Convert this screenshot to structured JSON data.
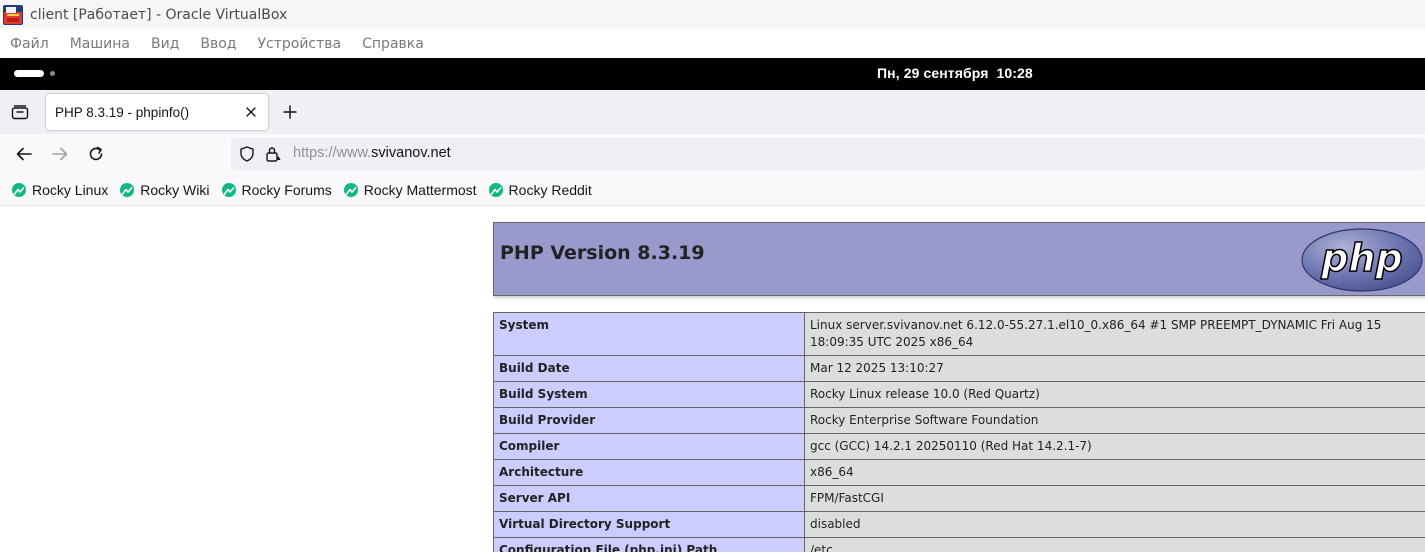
{
  "window": {
    "title": "client [Работает] - Oracle VirtualBox"
  },
  "vbox_menu": [
    "Файл",
    "Машина",
    "Вид",
    "Ввод",
    "Устройства",
    "Справка"
  ],
  "topbar": {
    "clock": "Пн, 29 сентября  10:28"
  },
  "browser": {
    "tab": {
      "title": "PHP 8.3.19 - phpinfo()"
    },
    "url": {
      "scheme": "https://www.",
      "host": "svivanov.net"
    },
    "bookmarks": [
      "Rocky Linux",
      "Rocky Wiki",
      "Rocky Forums",
      "Rocky Mattermost",
      "Rocky Reddit"
    ]
  },
  "phpinfo": {
    "heading": "PHP Version 8.3.19",
    "logo_text": "php",
    "rows": [
      {
        "key": "System",
        "value": "Linux server.svivanov.net 6.12.0-55.27.1.el10_0.x86_64 #1 SMP PREEMPT_DYNAMIC Fri Aug 15 18:09:35 UTC 2025 x86_64"
      },
      {
        "key": "Build Date",
        "value": "Mar 12 2025 13:10:27"
      },
      {
        "key": "Build System",
        "value": "Rocky Linux release 10.0 (Red Quartz)"
      },
      {
        "key": "Build Provider",
        "value": "Rocky Enterprise Software Foundation"
      },
      {
        "key": "Compiler",
        "value": "gcc (GCC) 14.2.1 20250110 (Red Hat 14.2.1-7)"
      },
      {
        "key": "Architecture",
        "value": "x86_64"
      },
      {
        "key": "Server API",
        "value": "FPM/FastCGI"
      },
      {
        "key": "Virtual Directory Support",
        "value": "disabled"
      },
      {
        "key": "Configuration File (php.ini) Path",
        "value": "/etc"
      }
    ]
  },
  "colors": {
    "php_header_bg": "#9999cc",
    "php_key_bg": "#ccccff",
    "php_value_bg": "#dddddd",
    "bookmark_icon": "#10b981"
  },
  "icons": {
    "app": "virtualbox-icon",
    "tab_manager": "tab-manager-icon",
    "tab_close": "close-icon",
    "new_tab": "plus-icon",
    "back": "arrow-left-icon",
    "forward": "arrow-right-icon",
    "reload": "reload-icon",
    "tracking": "shield-icon",
    "lock": "lock-icon",
    "bookmark": "rocky-logo-icon"
  }
}
